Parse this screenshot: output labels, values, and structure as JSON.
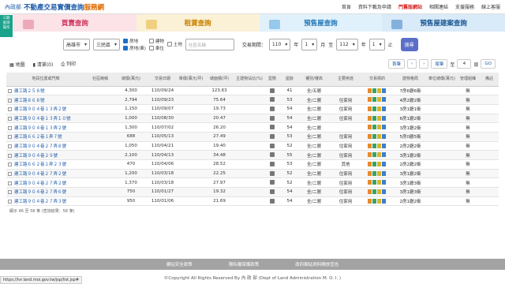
{
  "header": {
    "mark": "內政部",
    "title_main": "不動產交易實價查詢",
    "title_accent": "服務網",
    "nav": [
      "首頁",
      "資料下載及申請",
      "門舊版網站",
      "相關連結",
      "支援服務",
      "線上客服"
    ]
  },
  "side_badge": "手機",
  "side_badge_lines": [
    "三期",
    "查詢",
    "操作"
  ],
  "banner_tabs": [
    "買賣查詢",
    "租賃查詢",
    "預售屋查詢",
    "預售屋建案查詢"
  ],
  "filters": {
    "city": "高雄市",
    "district": "三民區",
    "types": [
      {
        "label": "房地",
        "checked": true
      },
      {
        "label": "建物",
        "checked": false
      },
      {
        "label": "土地",
        "checked": false
      },
      {
        "label": "房地(車)",
        "checked": true
      },
      {
        "label": "車位",
        "checked": false
      }
    ],
    "community_placeholder": "社區名稱",
    "period_label": "交易期間：",
    "from_year": "110",
    "from_month": "1",
    "to_year": "112",
    "to_month": "1",
    "sep_year": "年",
    "sep_month": "月",
    "to_label": "至",
    "end_label": "止",
    "search": "搜尋"
  },
  "toolbar": {
    "map": "地圖",
    "list": "清單(0)",
    "print": "列印",
    "first": "首筆",
    "last": "尾筆",
    "to": "至",
    "page": "4",
    "pages": "頁",
    "go": "GO"
  },
  "columns": [
    "地段位置或門牌",
    "社區簡稱",
    "總價(萬元)",
    "交易日期",
    "單價(萬元/坪)",
    "總面積(坪)",
    "主建物佔比(%)",
    "型態",
    "屋齡",
    "樓別/樓高",
    "主要用途",
    "交易標的",
    "建物格局",
    "車位總價(萬元)",
    "管理組織",
    "備註"
  ],
  "rows": [
    [
      "建工路２５８號",
      "",
      "4,300",
      "110/09/24",
      "",
      "123.63",
      "",
      "",
      "41",
      "全/五層",
      "",
      "",
      "7房6廳6衛",
      "",
      "無",
      ""
    ],
    [
      "建工路８６８號",
      "",
      "2,794",
      "110/09/23",
      "",
      "75.64",
      "",
      "",
      "53",
      "全/二層",
      "住家用",
      "",
      "4房2廳2衛",
      "",
      "無",
      ""
    ],
    [
      "建工路９０４巷１３弄２號",
      "",
      "1,150",
      "110/09/07",
      "",
      "19.73",
      "",
      "",
      "54",
      "全/二層",
      "住家用",
      "",
      "3房1廳1衛",
      "",
      "無",
      ""
    ],
    [
      "建工路９０４巷１３弄１０號",
      "",
      "1,000",
      "110/08/30",
      "",
      "20.47",
      "",
      "",
      "54",
      "全/二層",
      "住家用",
      "",
      "6房1廳2衛",
      "",
      "無",
      ""
    ],
    [
      "建工路９０４巷１３弄２號",
      "",
      "1,300",
      "110/07/02",
      "",
      "26.20",
      "",
      "",
      "54",
      "全/二層",
      "",
      "",
      "3房1廳2衛",
      "",
      "無",
      ""
    ],
    [
      "建工路６６２巷１弄７號",
      "",
      "688",
      "110/05/13",
      "",
      "27.49",
      "",
      "",
      "53",
      "全/二層",
      "住家用",
      "",
      "5房0廳5衛",
      "",
      "無",
      ""
    ],
    [
      "建工路９０４巷２７弄８號",
      "",
      "1,050",
      "110/04/21",
      "",
      "19.40",
      "",
      "",
      "52",
      "全/二層",
      "住家用",
      "",
      "2房2廳2衛",
      "",
      "無",
      ""
    ],
    [
      "建工路９０４巷２９號",
      "",
      "2,100",
      "110/04/13",
      "",
      "34.48",
      "",
      "",
      "55",
      "全/二層",
      "住家用",
      "",
      "3房1廳2衛",
      "",
      "無",
      ""
    ],
    [
      "建工路６６２巷１弄２３號",
      "",
      "470",
      "110/04/06",
      "",
      "28.52",
      "",
      "",
      "53",
      "全/二層",
      "其他",
      "",
      "2房2廳2衛",
      "",
      "無",
      ""
    ],
    [
      "建工路９０４巷２７弄２號",
      "",
      "1,200",
      "110/03/18",
      "",
      "22.25",
      "",
      "",
      "52",
      "全/二層",
      "住家用",
      "",
      "3房1廳2衛",
      "",
      "無",
      ""
    ],
    [
      "建工路９０４巷２７弄２號",
      "",
      "1,370",
      "110/03/18",
      "",
      "27.97",
      "",
      "",
      "52",
      "全/二層",
      "住家用",
      "",
      "3房1廳3衛",
      "",
      "無",
      ""
    ],
    [
      "建工路９０４巷２７弄６號",
      "",
      "750",
      "110/01/27",
      "",
      "19.32",
      "",
      "",
      "54",
      "全/二層",
      "住家用",
      "",
      "3房1廳3衛",
      "",
      "無",
      ""
    ],
    [
      "建工路９０４巷２７弄３號",
      "",
      "950",
      "110/01/06",
      "",
      "21.69",
      "",
      "",
      "54",
      "全/二層",
      "住家用",
      "",
      "2房1廳2衛",
      "",
      "無",
      ""
    ]
  ],
  "count_text": "顯示 46 至 58 筆 (查詢結果：58 筆)",
  "footer": {
    "links": [
      "網站安全政策",
      "隱私權保護政策",
      "政府網站資料開放宣告"
    ],
    "copyright": "©Copyright All Rights Reserved By 內 政 部 (Dept of Land Administration M. O. I. )"
  },
  "status_url": "https://lvr.land.moi.gov.tw/jsp/list.jsp#"
}
